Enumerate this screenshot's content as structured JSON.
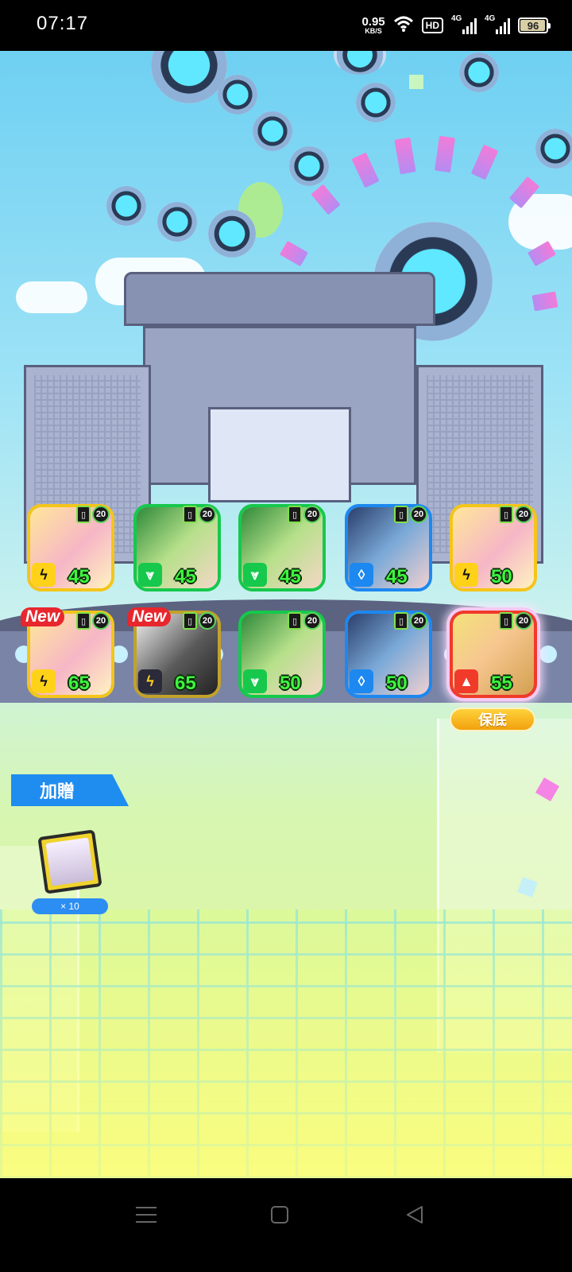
{
  "status_bar": {
    "time": "07:17",
    "net_speed_value": "0.95",
    "net_speed_unit": "KB/S",
    "hd_label": "HD",
    "signal1_label": "4G",
    "signal2_label": "4G",
    "battery_percent": "96",
    "battery_level": 0.96
  },
  "cards": [
    {
      "level": "45",
      "rank": "20",
      "element": "light",
      "element_icon": "light-element-icon",
      "is_new": false
    },
    {
      "level": "45",
      "rank": "20",
      "element": "wood",
      "element_icon": "wood-element-icon",
      "is_new": false
    },
    {
      "level": "45",
      "rank": "20",
      "element": "wood",
      "element_icon": "wood-element-icon",
      "is_new": false
    },
    {
      "level": "45",
      "rank": "20",
      "element": "water",
      "element_icon": "water-element-icon",
      "is_new": false
    },
    {
      "level": "50",
      "rank": "20",
      "element": "light",
      "element_icon": "light-element-icon",
      "is_new": false
    },
    {
      "level": "65",
      "rank": "20",
      "element": "light",
      "element_icon": "light-element-icon",
      "is_new": true
    },
    {
      "level": "65",
      "rank": "20",
      "element": "dark",
      "element_icon": "dark-element-icon",
      "is_new": true
    },
    {
      "level": "50",
      "rank": "20",
      "element": "wood",
      "element_icon": "wood-element-icon",
      "is_new": false
    },
    {
      "level": "50",
      "rank": "20",
      "element": "water",
      "element_icon": "water-element-icon",
      "is_new": false
    },
    {
      "level": "55",
      "rank": "20",
      "element": "fire",
      "element_icon": "fire-element-icon",
      "is_new": false
    }
  ],
  "new_label": "New",
  "guarantee_label": "保底",
  "bonus": {
    "title": "加贈",
    "count": "× 10"
  },
  "colors": {
    "light": "#f4c51a",
    "wood": "#16c84c",
    "water": "#1d88f0",
    "fire": "#f03a2a",
    "dark": "#c2a22a",
    "level_text": "#3ef43e",
    "accent_blue": "#1f8df0"
  },
  "nav": {
    "recent_icon": "menu-icon",
    "home_icon": "home-square-icon",
    "back_icon": "back-triangle-icon"
  }
}
